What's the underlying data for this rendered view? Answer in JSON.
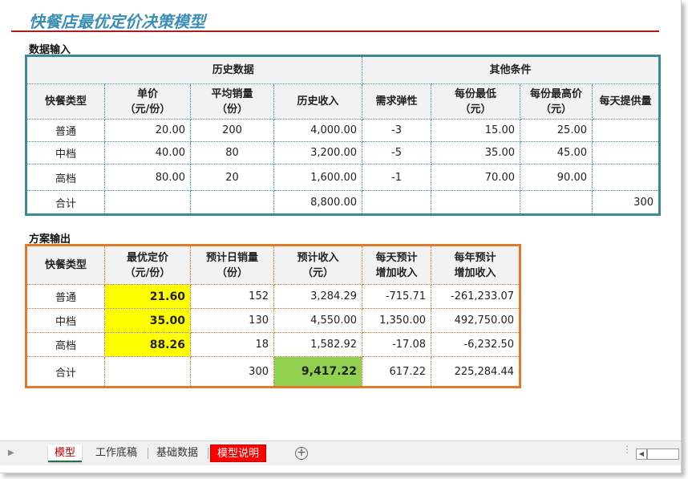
{
  "title": "快餐店最优定价决策模型",
  "input_section": {
    "label": "数据输入",
    "group_history": "历史数据",
    "group_other": "其他条件",
    "headers": {
      "type": "快餐类型",
      "price_l1": "单价",
      "price_l2": "（元/份）",
      "avg_sales_l1": "平均销量",
      "avg_sales_l2": "（份）",
      "hist_income": "历史收入",
      "elasticity": "需求弹性",
      "min_price_l1": "每份最低",
      "min_price_l2": "（元）",
      "max_price_l1": "每份最高价",
      "max_price_l2": "（元）",
      "daily_supply": "每天提供量"
    },
    "rows": [
      {
        "type": "普通",
        "price": "20.00",
        "sales": "200",
        "income": "4,000.00",
        "elasticity": "-3",
        "min": "15.00",
        "max": "25.00",
        "supply": ""
      },
      {
        "type": "中档",
        "price": "40.00",
        "sales": "80",
        "income": "3,200.00",
        "elasticity": "-5",
        "min": "35.00",
        "max": "45.00",
        "supply": ""
      },
      {
        "type": "高档",
        "price": "80.00",
        "sales": "20",
        "income": "1,600.00",
        "elasticity": "-1",
        "min": "70.00",
        "max": "90.00",
        "supply": ""
      }
    ],
    "total": {
      "type": "合计",
      "price": "",
      "sales": "",
      "income": "8,800.00",
      "elasticity": "",
      "min": "",
      "max": "",
      "supply": "300"
    }
  },
  "output_section": {
    "label": "方案输出",
    "headers": {
      "type": "快餐类型",
      "opt_price_l1": "最优定价",
      "opt_price_l2": "（元/份）",
      "daily_sales_l1": "预计日销量",
      "daily_sales_l2": "（份）",
      "exp_income_l1": "预计收入",
      "exp_income_l2": "（元）",
      "daily_add_l1": "每天预计",
      "daily_add_l2": "增加收入",
      "yearly_add_l1": "每年预计",
      "yearly_add_l2": "增加收入"
    },
    "rows": [
      {
        "type": "普通",
        "price": "21.60",
        "sales": "152",
        "income": "3,284.29",
        "daily_add": "-715.71",
        "yearly_add": "-261,233.07"
      },
      {
        "type": "中档",
        "price": "35.00",
        "sales": "130",
        "income": "4,550.00",
        "daily_add": "1,350.00",
        "yearly_add": "492,750.00"
      },
      {
        "type": "高档",
        "price": "88.26",
        "sales": "18",
        "income": "1,582.92",
        "daily_add": "-17.08",
        "yearly_add": "-6,232.50"
      }
    ],
    "total": {
      "type": "合计",
      "price": "",
      "sales": "300",
      "income": "9,417.22",
      "daily_add": "617.22",
      "yearly_add": "225,284.44"
    }
  },
  "sheet_tabs": {
    "items": [
      "模型",
      "工作底稿",
      "基础数据",
      "模型说明"
    ],
    "active": "模型"
  },
  "colors": {
    "title": "#3b8fb5",
    "title_rule": "#b31a1a",
    "input_border": "#3d8a95",
    "output_border": "#e07a2a",
    "highlight_price": "#ffff00",
    "highlight_income": "#92d050",
    "tab_red": "#ff0000"
  },
  "icons": [
    "scroll-left-icon",
    "add-sheet-icon"
  ]
}
